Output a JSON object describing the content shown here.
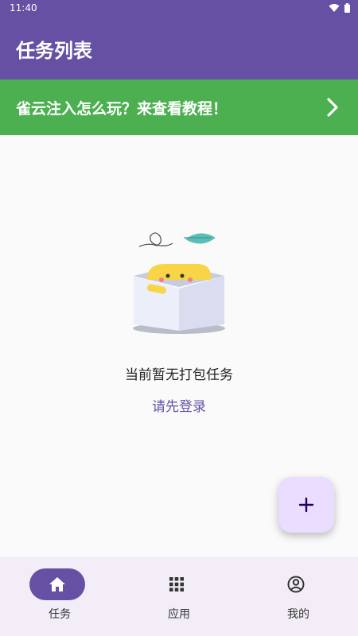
{
  "status_bar": {
    "time": "11:40"
  },
  "app_bar": {
    "title": "任务列表"
  },
  "banner": {
    "text": "雀云注入怎么玩？来查看教程！"
  },
  "empty_state": {
    "message": "当前暂无打包任务",
    "login_link": "请先登录"
  },
  "fab": {
    "icon": "plus-icon"
  },
  "bottom_nav": {
    "items": [
      {
        "label": "任务",
        "icon": "home-icon",
        "active": true
      },
      {
        "label": "应用",
        "icon": "apps-grid-icon",
        "active": false
      },
      {
        "label": "我的",
        "icon": "account-icon",
        "active": false
      }
    ]
  },
  "colors": {
    "primary": "#6650a4",
    "banner": "#4caf50",
    "fab_bg": "#eaddff",
    "nav_bg": "#f3edf7",
    "background": "#fafafa"
  }
}
